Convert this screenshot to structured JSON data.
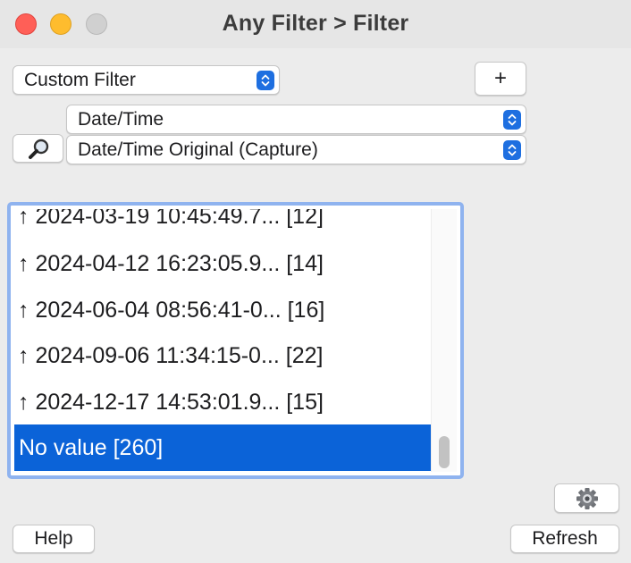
{
  "window": {
    "title": "Any Filter > Filter"
  },
  "filter_type": {
    "selected": "Custom Filter"
  },
  "add_label": "+",
  "category": {
    "selected": "Date/Time"
  },
  "field": {
    "selected": "Date/Time Original (Capture)"
  },
  "list": {
    "items": [
      "↑ 2024-03-19 10:45:49.7... [12]",
      "↑ 2024-04-12 16:23:05.9... [14]",
      "↑ 2024-06-04 08:56:41-0... [16]",
      "↑ 2024-09-06 11:34:15-0... [22]",
      "↑ 2024-12-17 14:53:01.9... [15]",
      "No value [260]"
    ],
    "selected_index": 5
  },
  "buttons": {
    "help": "Help",
    "refresh": "Refresh"
  },
  "icons": {
    "search": "magnifier-icon",
    "settings": "gear-icon"
  },
  "colors": {
    "selection": "#0b63d8",
    "focus_ring": "#8fb3ef",
    "stepper": "#1e6fe0"
  }
}
